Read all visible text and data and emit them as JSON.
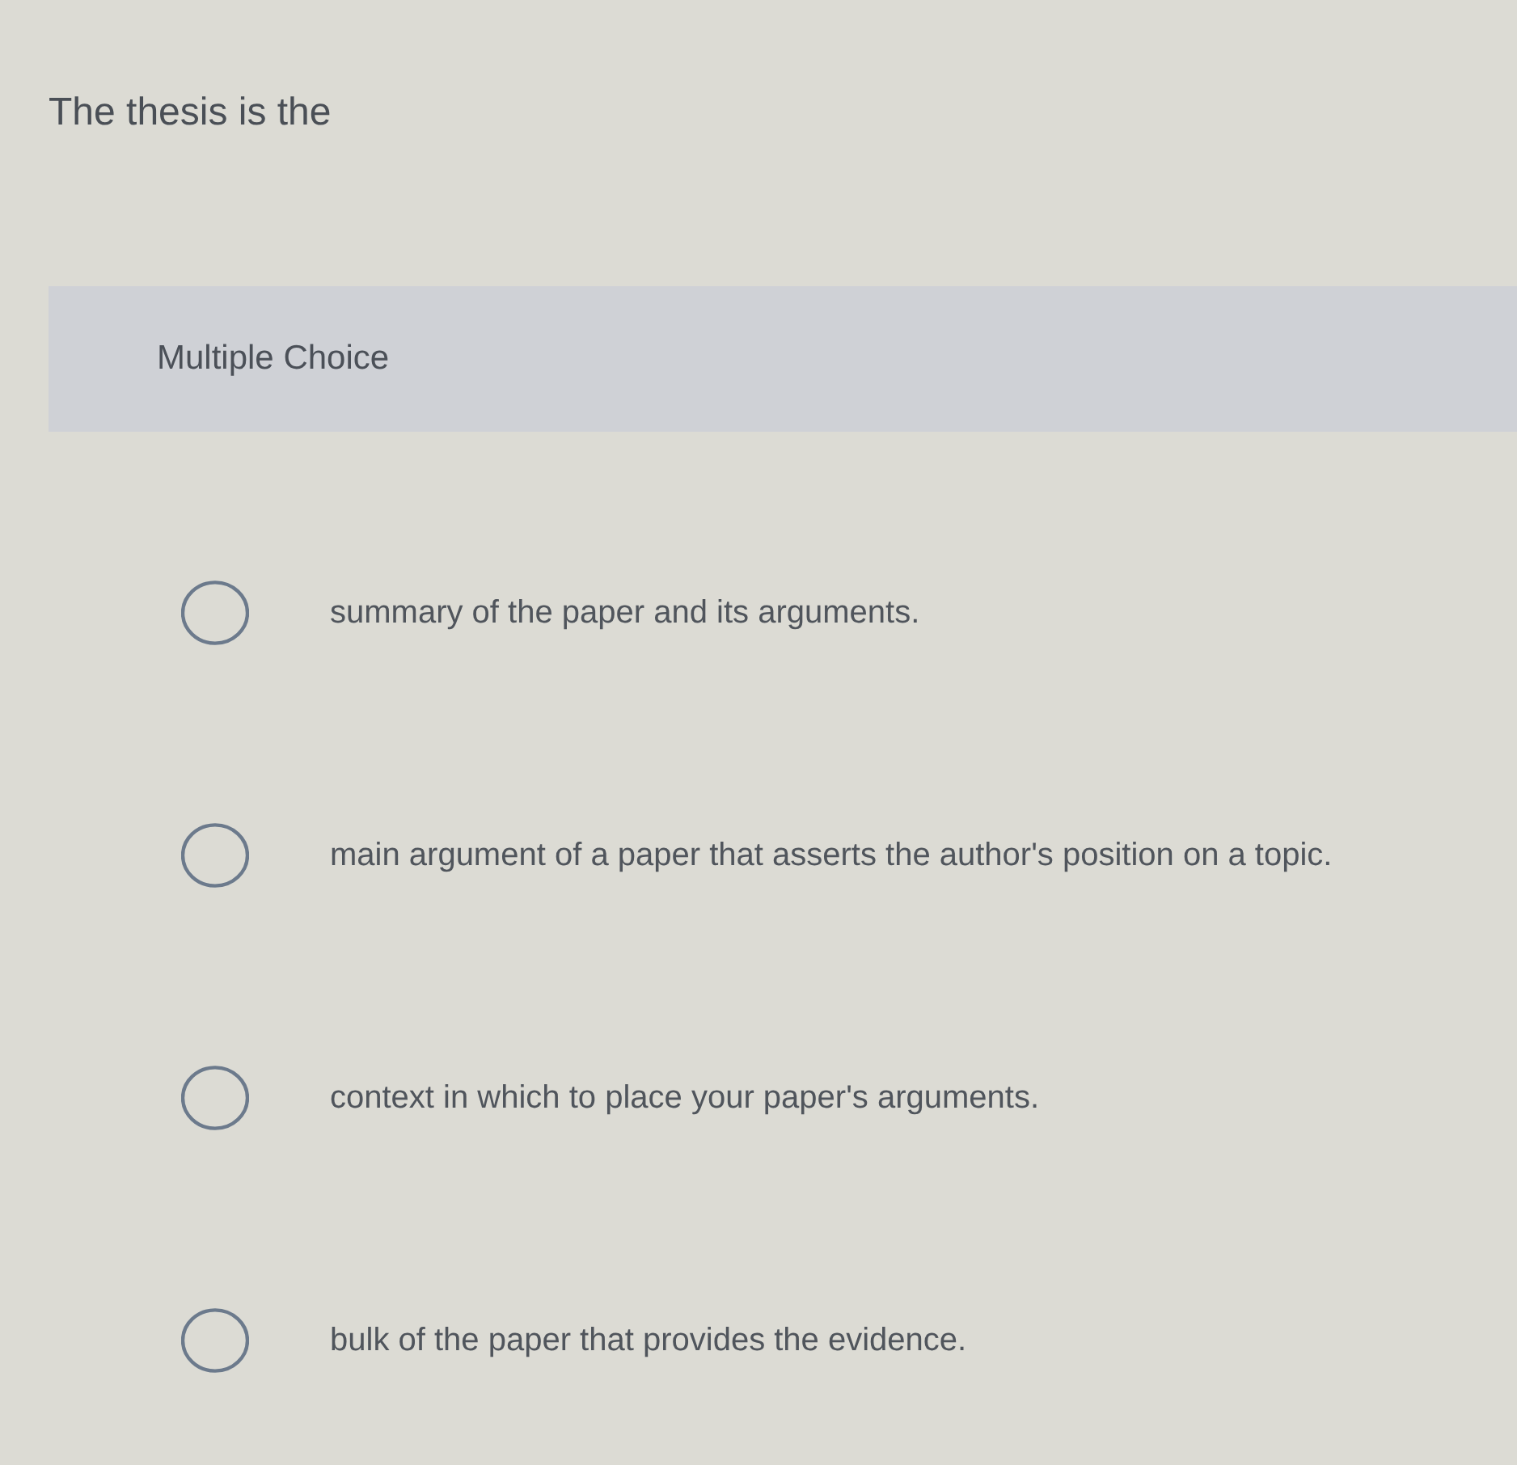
{
  "question": {
    "text": "The thesis is the"
  },
  "section": {
    "title": "Multiple Choice"
  },
  "options": [
    {
      "text": "summary of the paper and its arguments.",
      "selected": false
    },
    {
      "text": "main argument of a paper that asserts the author's position on a topic.",
      "selected": false
    },
    {
      "text": "context in which to place your paper's arguments.",
      "selected": false
    },
    {
      "text": "bulk of the paper that provides the evidence.",
      "selected": false
    }
  ]
}
